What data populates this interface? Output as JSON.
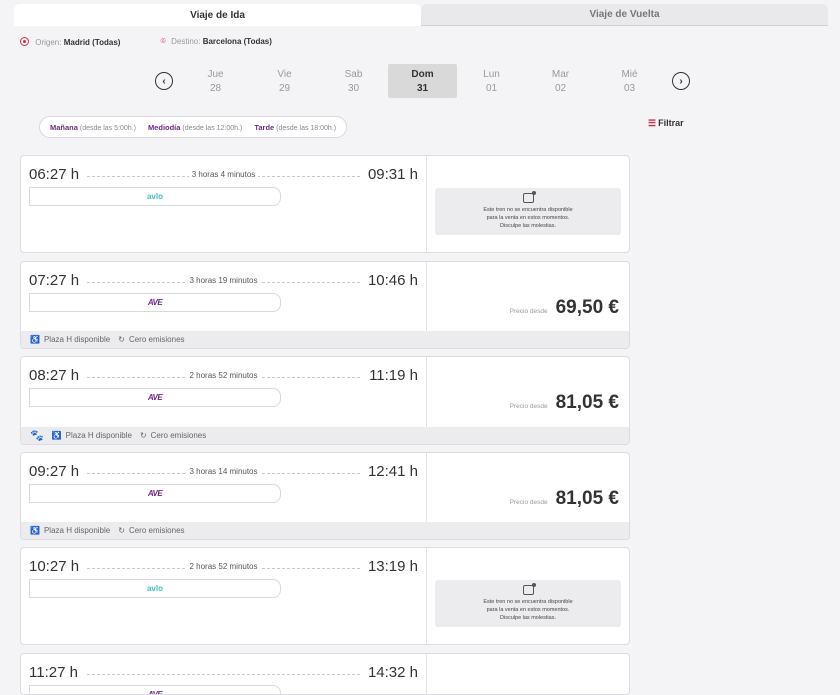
{
  "tabs": [
    {
      "label": "Viaje de Ida",
      "active": true
    },
    {
      "label": "Viaje de Vuelta",
      "active": false
    }
  ],
  "route": {
    "origin_label": "Origen:",
    "origin_value": "Madrid",
    "origin_extra": "(Todas)",
    "destination_label": "Destino:",
    "destination_value": "Barcelona",
    "destination_extra": "(Todas)"
  },
  "days": [
    {
      "name": "Jue",
      "num": "28",
      "selected": false
    },
    {
      "name": "Vie",
      "num": "29",
      "selected": false
    },
    {
      "name": "Sab",
      "num": "30",
      "selected": false
    },
    {
      "name": "Dom",
      "num": "31",
      "selected": true
    },
    {
      "name": "Lun",
      "num": "01",
      "selected": false
    },
    {
      "name": "Mar",
      "num": "02",
      "selected": false
    },
    {
      "name": "Mié",
      "num": "03",
      "selected": false
    }
  ],
  "time_filters": [
    {
      "label": "Mañana",
      "hint": "(desde las 5:00h.)"
    },
    {
      "label": "Mediodía",
      "hint": "(desde las 12:00h.)"
    },
    {
      "label": "Tarde",
      "hint": "(desde las 18:00h.)"
    }
  ],
  "filter_label": "Filtrar",
  "trips": [
    {
      "dep": "06:27 h",
      "arr": "09:31 h",
      "duration": "3 horas 4 minutos",
      "brand": "avlo",
      "brand_text": "avlo",
      "status": "unavailable",
      "unavailable_text": "Este tren no se encuentra disponible para la venta en estos momentos. Disculpe las molestias.",
      "features": [],
      "pet": false
    },
    {
      "dep": "07:27 h",
      "arr": "10:46 h",
      "duration": "3 horas 19 minutos",
      "brand": "ave",
      "brand_text": "AVE",
      "status": "available",
      "price_from": "Precio desde",
      "price": "69,50 €",
      "features": [
        "Plaza H disponible",
        "Cero emisiones"
      ],
      "pet": false
    },
    {
      "dep": "08:27 h",
      "arr": "11:19 h",
      "duration": "2 horas 52 minutos",
      "brand": "ave",
      "brand_text": "AVE",
      "status": "available",
      "price_from": "Precio desde",
      "price": "81,05 €",
      "features": [
        "Plaza H disponible",
        "Cero emisiones"
      ],
      "pet": true
    },
    {
      "dep": "09:27 h",
      "arr": "12:41 h",
      "duration": "3 horas 14 minutos",
      "brand": "ave",
      "brand_text": "AVE",
      "status": "available",
      "price_from": "Precio desde",
      "price": "81,05 €",
      "features": [
        "Plaza H disponible",
        "Cero emisiones"
      ],
      "pet": false
    },
    {
      "dep": "10:27 h",
      "arr": "13:19 h",
      "duration": "2 horas 52 minutos",
      "brand": "avlo",
      "brand_text": "avlo",
      "status": "unavailable",
      "unavailable_text": "Este tren no se encuentra disponible para la venta en estos momentos. Disculpe las molestias.",
      "features": [],
      "pet": false
    },
    {
      "dep": "11:27 h",
      "arr": "14:32 h",
      "duration": "",
      "brand": "ave",
      "brand_text": "AVE",
      "status": "available",
      "price_from": "",
      "price": "",
      "features": [],
      "pet": false
    }
  ],
  "colors": {
    "accent": "#6b2a8a",
    "avlo": "#3cc7c2",
    "icon_red": "#d0304a"
  }
}
